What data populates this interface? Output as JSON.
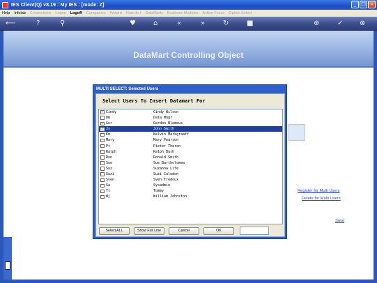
{
  "window": {
    "title": "IES Client(Q) v8.19 : My IES : [mode: Z]"
  },
  "menu": {
    "items": [
      {
        "label": "Help",
        "enabled": true
      },
      {
        "label": "Infolab",
        "enabled": true
      },
      {
        "label": "Connections",
        "enabled": false
      },
      {
        "label": "Logon",
        "enabled": false
      },
      {
        "label": "Logoff",
        "enabled": true,
        "strong": true
      },
      {
        "label": "Companies",
        "enabled": false
      },
      {
        "label": "Wizard",
        "enabled": false
      },
      {
        "label": "How do I",
        "enabled": false
      },
      {
        "label": "DataMarts",
        "enabled": false
      },
      {
        "label": "Business Modules",
        "enabled": false
      },
      {
        "label": "Action Focus",
        "enabled": false
      },
      {
        "label": "Option Select",
        "enabled": false
      }
    ]
  },
  "toolbar": {
    "icons": [
      "back-arrow-icon",
      "help-icon",
      "search-icon",
      "heart-icon",
      "home-icon",
      "rewind-icon",
      "fast-forward-icon",
      "refresh-icon",
      "stop-icon",
      "plus-icon",
      "check-icon",
      "close-icon"
    ]
  },
  "banner": {
    "title": "DataMart Controlling Object"
  },
  "links": {
    "register": "Register for Multi Users",
    "delete": "Delete for Multi Users",
    "save": "Save"
  },
  "dialog": {
    "title": "MULTI SELECT: Selected Users",
    "heading": "Select Users To Insert Datamart For",
    "rows": [
      {
        "code": "Cindy",
        "name": "Cindy Wilson",
        "checked": true,
        "selected": false
      },
      {
        "code": "Dm",
        "name": "Data Mngr",
        "checked": false,
        "selected": false
      },
      {
        "code": "Gor",
        "name": "Gordon Blomeus",
        "checked": true,
        "selected": false
      },
      {
        "code": "Js",
        "name": "John Smith",
        "checked": true,
        "selected": true
      },
      {
        "code": "Km",
        "name": "Kelvin Markgraaff",
        "checked": false,
        "selected": false
      },
      {
        "code": "Mary",
        "name": "Mary Pearson",
        "checked": false,
        "selected": false
      },
      {
        "code": "Pt",
        "name": "Pieter Theron",
        "checked": false,
        "selected": false
      },
      {
        "code": "Ralph",
        "name": "Ralph Bush",
        "checked": false,
        "selected": false
      },
      {
        "code": "Ron",
        "name": "Ronald Smith",
        "checked": false,
        "selected": false
      },
      {
        "code": "Sue",
        "name": "Sue Bartholomew",
        "checked": false,
        "selected": false
      },
      {
        "code": "Suz",
        "name": "Suzanna Lite",
        "checked": false,
        "selected": false
      },
      {
        "code": "Suzi",
        "name": "Suzi Caledon",
        "checked": false,
        "selected": false
      },
      {
        "code": "Sven",
        "name": "Sven Tredoux",
        "checked": false,
        "selected": false
      },
      {
        "code": "Sa",
        "name": "Sysadmin",
        "checked": false,
        "selected": false
      },
      {
        "code": "Tt",
        "name": "Tommy",
        "checked": false,
        "selected": false
      },
      {
        "code": "Wj",
        "name": "William Johnston",
        "checked": false,
        "selected": false
      }
    ],
    "buttons": {
      "select_all": "Select ALL",
      "show_full_line": "Show Full Line",
      "cancel": "Cancel",
      "ok": "OK"
    },
    "input_value": ""
  },
  "colors": {
    "accent": "#2f5fc8",
    "selection": "#1f3f9a",
    "link": "#2d47d8"
  }
}
